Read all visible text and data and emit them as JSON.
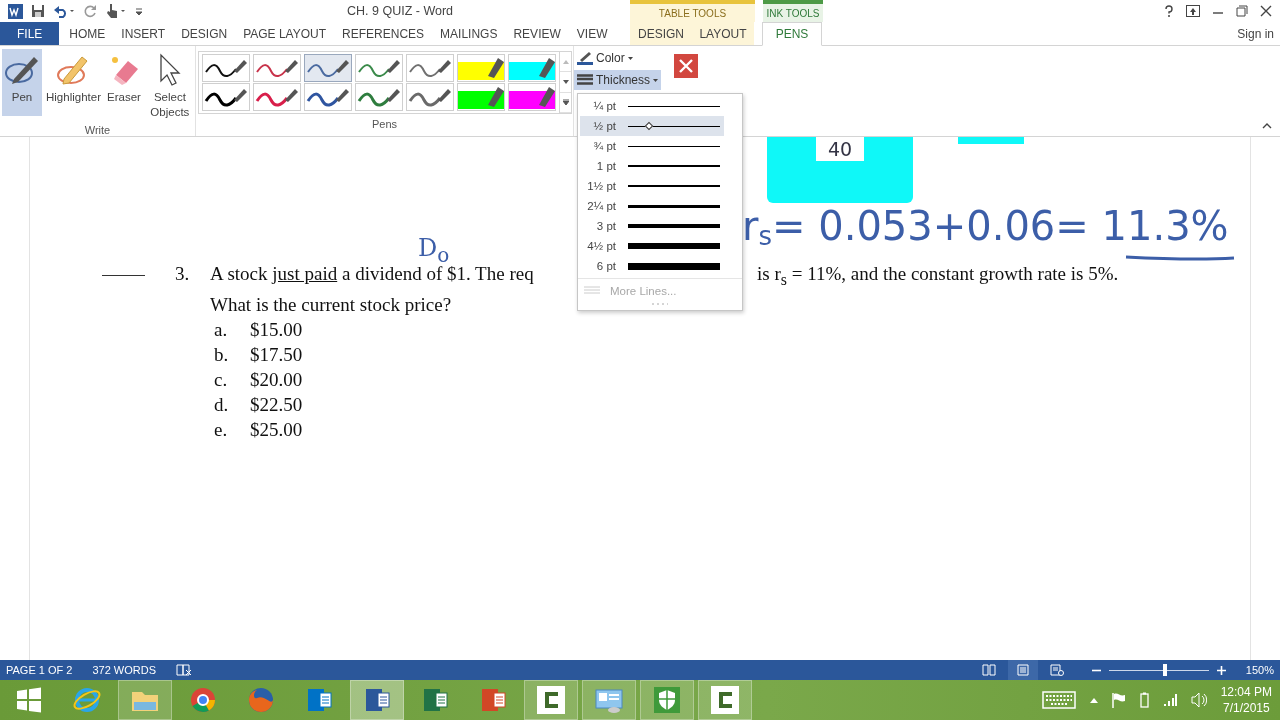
{
  "title_bar": {
    "title": "CH. 9 QUIZ - Word",
    "contextual": [
      {
        "label": "TABLE TOOLS",
        "kind": "table"
      },
      {
        "label": "INK TOOLS",
        "kind": "ink"
      }
    ]
  },
  "tabs": [
    {
      "label": "FILE",
      "kind": "file",
      "selected": false
    },
    {
      "label": "HOME",
      "kind": "normal",
      "selected": false
    },
    {
      "label": "INSERT",
      "kind": "normal",
      "selected": false
    },
    {
      "label": "DESIGN",
      "kind": "normal",
      "selected": false
    },
    {
      "label": "PAGE LAYOUT",
      "kind": "normal",
      "selected": false
    },
    {
      "label": "REFERENCES",
      "kind": "normal",
      "selected": false
    },
    {
      "label": "MAILINGS",
      "kind": "normal",
      "selected": false
    },
    {
      "label": "REVIEW",
      "kind": "normal",
      "selected": false
    },
    {
      "label": "VIEW",
      "kind": "normal",
      "selected": false
    },
    {
      "label": "DESIGN",
      "kind": "table",
      "selected": false
    },
    {
      "label": "LAYOUT",
      "kind": "table",
      "selected": false
    },
    {
      "label": "PENS",
      "kind": "ink",
      "selected": true
    }
  ],
  "sign_in": "Sign in",
  "write_group": {
    "label": "Write",
    "tools": [
      {
        "label": "Pen",
        "kind": "pen",
        "selected": true
      },
      {
        "label": "Highlighter",
        "kind": "highlighter",
        "selected": false
      },
      {
        "label": "Eraser",
        "kind": "eraser",
        "selected": false
      },
      {
        "label": "Select Objects",
        "kind": "select",
        "selected": false
      }
    ]
  },
  "pens_group": {
    "label": "Pens",
    "pens": [
      {
        "kind": "pen",
        "color": "#111111",
        "selected": false
      },
      {
        "kind": "pen",
        "color": "#c8324a",
        "selected": false
      },
      {
        "kind": "pen",
        "color": "#4a6aa0",
        "selected": true
      },
      {
        "kind": "pen",
        "color": "#3a8a4a",
        "selected": false
      },
      {
        "kind": "pen",
        "color": "#707070",
        "selected": false
      },
      {
        "kind": "highlighter",
        "color": "#ffff00",
        "selected": false
      },
      {
        "kind": "highlighter",
        "color": "#00ffff",
        "selected": false
      },
      {
        "kind": "pen",
        "color": "#000000",
        "selected": false
      },
      {
        "kind": "pen",
        "color": "#d81e4a",
        "selected": false
      },
      {
        "kind": "pen",
        "color": "#2f55a0",
        "selected": false
      },
      {
        "kind": "pen",
        "color": "#2e7d3e",
        "selected": false
      },
      {
        "kind": "pen",
        "color": "#6a6a6a",
        "selected": false
      },
      {
        "kind": "highlighter",
        "color": "#00ff00",
        "selected": false
      },
      {
        "kind": "highlighter",
        "color": "#ff00ff",
        "selected": false
      }
    ]
  },
  "color_button": {
    "label": "Color"
  },
  "thickness_button": {
    "label": "Thickness",
    "expanded": true
  },
  "thickness_menu": {
    "items": [
      {
        "label": "¼ pt",
        "selected": false
      },
      {
        "label": "½ pt",
        "selected": true
      },
      {
        "label": "¾ pt",
        "selected": false
      },
      {
        "label": "1 pt",
        "selected": false
      },
      {
        "label": "1½ pt",
        "selected": false
      },
      {
        "label": "2¼ pt",
        "selected": false
      },
      {
        "label": "3 pt",
        "selected": false
      },
      {
        "label": "4½ pt",
        "selected": false
      },
      {
        "label": "6 pt",
        "selected": false
      }
    ],
    "more": {
      "label": "More Lines...",
      "disabled": true
    }
  },
  "document": {
    "question": {
      "number": "3.",
      "parts": [
        {
          "text": "A stock ",
          "underline": false
        },
        {
          "text": "just paid",
          "underline": true
        },
        {
          "text": " a dividend of $1. The req",
          "underline": false
        }
      ],
      "continuation": "is r$_{s}$ = 11%, and the constant growth rate is 5%.",
      "second_line": "What is the current stock price?",
      "choices": [
        {
          "letter": "a.",
          "text": "$15.00"
        },
        {
          "letter": "b.",
          "text": "$17.50"
        },
        {
          "letter": "c.",
          "text": "$20.00"
        },
        {
          "letter": "d.",
          "text": "$22.50"
        },
        {
          "letter": "e.",
          "text": "$25.00"
        }
      ]
    }
  },
  "ink": {
    "box_note": "40",
    "formula": "r$_{s}$= 0.053+0.06= 11.3%",
    "note": "D$_{o}$"
  },
  "status_bar": {
    "page": "PAGE 1 OF 2",
    "words": "372 WORDS",
    "views": [
      {
        "kind": "read",
        "selected": false
      },
      {
        "kind": "print",
        "selected": true
      },
      {
        "kind": "web",
        "selected": false
      }
    ],
    "zoom": {
      "level": 0.56,
      "reading": "150%"
    }
  },
  "taskbar": {
    "apps": [
      {
        "kind": "ie",
        "running": false,
        "selected": false
      },
      {
        "kind": "explorer",
        "running": true,
        "selected": false
      },
      {
        "kind": "chrome",
        "running": false,
        "selected": false
      },
      {
        "kind": "firefox",
        "running": false,
        "selected": false
      },
      {
        "kind": "outlook",
        "running": false,
        "selected": false
      },
      {
        "kind": "word",
        "running": true,
        "selected": true
      },
      {
        "kind": "excel",
        "running": false,
        "selected": false
      },
      {
        "kind": "powerpoint",
        "running": false,
        "selected": false
      },
      {
        "kind": "camtasia",
        "running": true,
        "selected": false
      },
      {
        "kind": "control",
        "running": true,
        "selected": false
      },
      {
        "kind": "defender",
        "running": true,
        "selected": false
      },
      {
        "kind": "camtasia",
        "running": true,
        "selected": false
      }
    ],
    "time": "12:04 PM",
    "date": "7/1/2015"
  }
}
